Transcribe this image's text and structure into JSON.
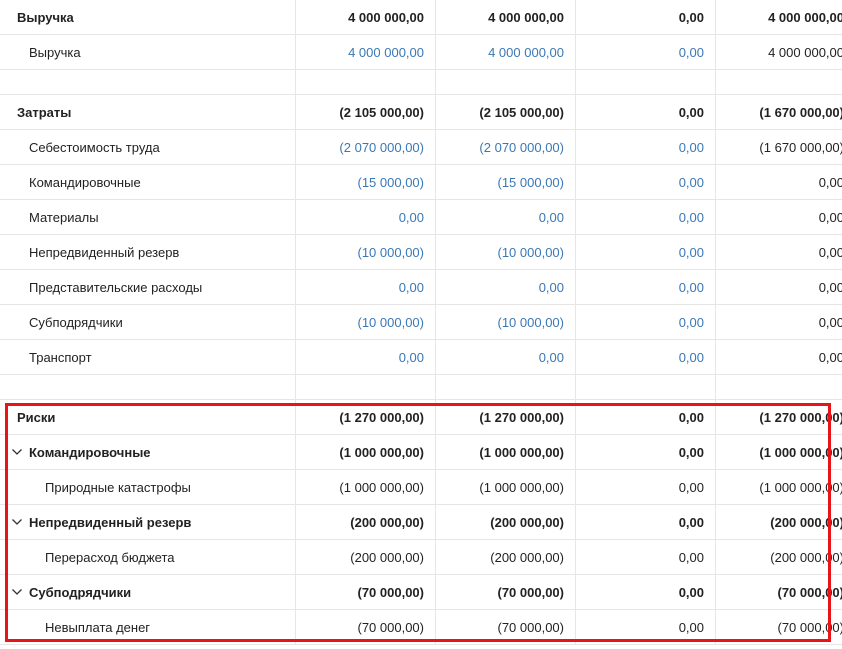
{
  "rows": [
    {
      "kind": "row",
      "level": 0,
      "bold": true,
      "label": "Выручка",
      "vals": [
        "4 000 000,00",
        "4 000 000,00",
        "0,00",
        "4 000 000,00"
      ],
      "links": [
        false,
        false,
        false,
        false
      ]
    },
    {
      "kind": "row",
      "level": 1,
      "bold": false,
      "label": "Выручка",
      "vals": [
        "4 000 000,00",
        "4 000 000,00",
        "0,00",
        "4 000 000,00"
      ],
      "links": [
        true,
        true,
        true,
        false
      ]
    },
    {
      "kind": "spacer"
    },
    {
      "kind": "row",
      "level": 0,
      "bold": true,
      "label": "Затраты",
      "vals": [
        "(2 105 000,00)",
        "(2 105 000,00)",
        "0,00",
        "(1 670 000,00)"
      ],
      "links": [
        false,
        false,
        false,
        false
      ]
    },
    {
      "kind": "row",
      "level": 1,
      "bold": false,
      "label": "Себестоимость труда",
      "vals": [
        "(2 070 000,00)",
        "(2 070 000,00)",
        "0,00",
        "(1 670 000,00)"
      ],
      "links": [
        true,
        true,
        true,
        false
      ]
    },
    {
      "kind": "row",
      "level": 1,
      "bold": false,
      "label": "Командировочные",
      "vals": [
        "(15 000,00)",
        "(15 000,00)",
        "0,00",
        "0,00"
      ],
      "links": [
        true,
        true,
        true,
        false
      ]
    },
    {
      "kind": "row",
      "level": 1,
      "bold": false,
      "label": "Материалы",
      "vals": [
        "0,00",
        "0,00",
        "0,00",
        "0,00"
      ],
      "links": [
        true,
        true,
        true,
        false
      ]
    },
    {
      "kind": "row",
      "level": 1,
      "bold": false,
      "label": "Непредвиденный резерв",
      "vals": [
        "(10 000,00)",
        "(10 000,00)",
        "0,00",
        "0,00"
      ],
      "links": [
        true,
        true,
        true,
        false
      ]
    },
    {
      "kind": "row",
      "level": 1,
      "bold": false,
      "label": "Представительские расходы",
      "vals": [
        "0,00",
        "0,00",
        "0,00",
        "0,00"
      ],
      "links": [
        true,
        true,
        true,
        false
      ]
    },
    {
      "kind": "row",
      "level": 1,
      "bold": false,
      "label": "Субподрядчики",
      "vals": [
        "(10 000,00)",
        "(10 000,00)",
        "0,00",
        "0,00"
      ],
      "links": [
        true,
        true,
        true,
        false
      ]
    },
    {
      "kind": "row",
      "level": 1,
      "bold": false,
      "label": "Транспорт",
      "vals": [
        "0,00",
        "0,00",
        "0,00",
        "0,00"
      ],
      "links": [
        true,
        true,
        true,
        false
      ]
    },
    {
      "kind": "spacer"
    },
    {
      "kind": "row",
      "level": 0,
      "bold": true,
      "label": "Риски",
      "vals": [
        "(1 270 000,00)",
        "(1 270 000,00)",
        "0,00",
        "(1 270 000,00)"
      ],
      "links": [
        false,
        false,
        false,
        false
      ]
    },
    {
      "kind": "row",
      "level": "x",
      "bold": true,
      "expander": true,
      "label": "Командировочные",
      "vals": [
        "(1 000 000,00)",
        "(1 000 000,00)",
        "0,00",
        "(1 000 000,00)"
      ],
      "links": [
        false,
        false,
        false,
        false
      ]
    },
    {
      "kind": "row",
      "level": 2,
      "bold": false,
      "label": "Природные катастрофы",
      "vals": [
        "(1 000 000,00)",
        "(1 000 000,00)",
        "0,00",
        "(1 000 000,00)"
      ],
      "links": [
        false,
        false,
        false,
        false
      ]
    },
    {
      "kind": "row",
      "level": "x",
      "bold": true,
      "expander": true,
      "label": "Непредвиденный резерв",
      "vals": [
        "(200 000,00)",
        "(200 000,00)",
        "0,00",
        "(200 000,00)"
      ],
      "links": [
        false,
        false,
        false,
        false
      ]
    },
    {
      "kind": "row",
      "level": 2,
      "bold": false,
      "label": "Перерасход бюджета",
      "vals": [
        "(200 000,00)",
        "(200 000,00)",
        "0,00",
        "(200 000,00)"
      ],
      "links": [
        false,
        false,
        false,
        false
      ]
    },
    {
      "kind": "row",
      "level": "x",
      "bold": true,
      "expander": true,
      "label": "Субподрядчики",
      "vals": [
        "(70 000,00)",
        "(70 000,00)",
        "0,00",
        "(70 000,00)"
      ],
      "links": [
        false,
        false,
        false,
        false
      ]
    },
    {
      "kind": "row",
      "level": 2,
      "bold": false,
      "label": "Невыплата денег",
      "vals": [
        "(70 000,00)",
        "(70 000,00)",
        "0,00",
        "(70 000,00)"
      ],
      "links": [
        false,
        false,
        false,
        false
      ]
    }
  ],
  "colors": {
    "link": "#3a78b5",
    "highlight": "#e8141a",
    "grid": "#e6e6e6"
  },
  "icons": {
    "expander": "chevron-down-icon"
  }
}
